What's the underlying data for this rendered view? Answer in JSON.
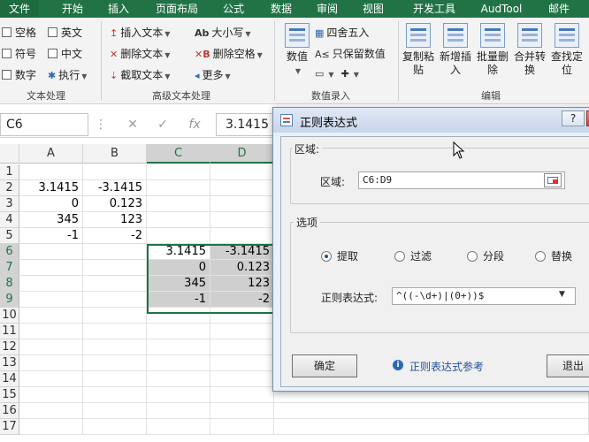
{
  "ribbon_tabs": [
    "文件",
    "开始",
    "插入",
    "页面布局",
    "公式",
    "数据",
    "审阅",
    "视图",
    "开发工具",
    "AudTool",
    "邮件"
  ],
  "text_group": {
    "checks": [
      "空格",
      "英文",
      "符号",
      "中文",
      "数字"
    ],
    "execute": "执行",
    "label": "文本处理"
  },
  "advanced_group": {
    "insert_text": "插入文本",
    "delete_text": "删除文本",
    "extract_text": "截取文本",
    "upper_lower": "大小写",
    "delete_spaces": "删除空格",
    "more": "更多",
    "label": "高级文本处理"
  },
  "numeric_group": {
    "value_btn": "数值",
    "round": "四舍五入",
    "keep_values": "只保留数值",
    "label": "数值录入"
  },
  "edit_group": {
    "buttons": [
      "复制粘贴",
      "新增插入",
      "批量删除",
      "合并转换",
      "查找定位"
    ],
    "label": "编辑"
  },
  "formula_bar": {
    "namebox": "C6",
    "value": "3.1415"
  },
  "grid": {
    "columns": [
      "A",
      "B",
      "C",
      "D"
    ],
    "rows": [
      "1",
      "2",
      "3",
      "4",
      "5",
      "6",
      "7",
      "8",
      "9",
      "10",
      "11",
      "12",
      "13",
      "14",
      "15",
      "16",
      "17"
    ],
    "A": [
      "",
      "3.1415",
      "0",
      "345",
      "-1"
    ],
    "B": [
      "",
      "-3.1415",
      "0.123",
      "123",
      "-2"
    ],
    "C": [
      "3.1415",
      "0",
      "345",
      "-1"
    ],
    "D": [
      "-3.1415",
      "0.123",
      "123",
      "-2"
    ]
  },
  "dialog": {
    "title": "正则表达式",
    "help": "?",
    "area_section": "区域:",
    "area_label": "区域:",
    "area_value": "C6:D9",
    "options_section": "选项",
    "options": [
      "提取",
      "过滤",
      "分段",
      "替换"
    ],
    "regex_label": "正则表达式:",
    "regex_value": "^((-\\d+)|(0+))$",
    "ok": "确定",
    "reference_link": "正则表达式参考",
    "exit": "退出"
  }
}
